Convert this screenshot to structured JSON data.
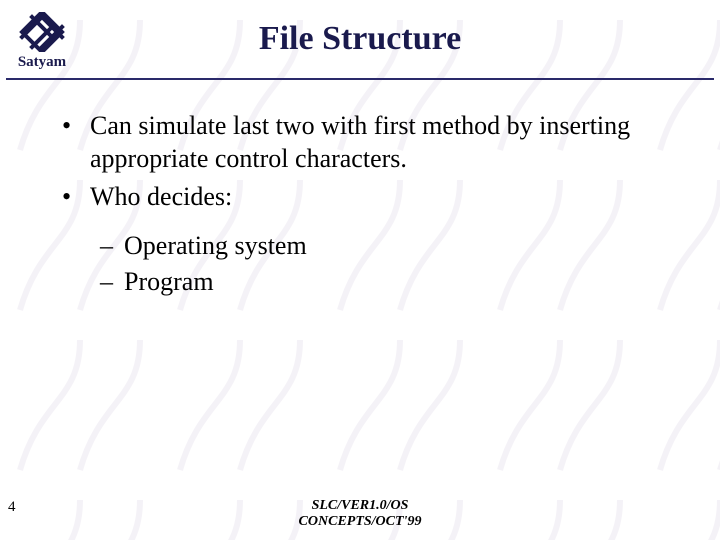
{
  "logo": {
    "text": "Satyam"
  },
  "title": "File Structure",
  "bullets": [
    "Can simulate last two with first method by inserting appropriate control characters.",
    "Who decides:"
  ],
  "subitems": [
    "Operating system",
    "Program"
  ],
  "footer": {
    "page": "4",
    "line1": "SLC/VER1.0/OS",
    "line2": "CONCEPTS/OCT'99"
  }
}
